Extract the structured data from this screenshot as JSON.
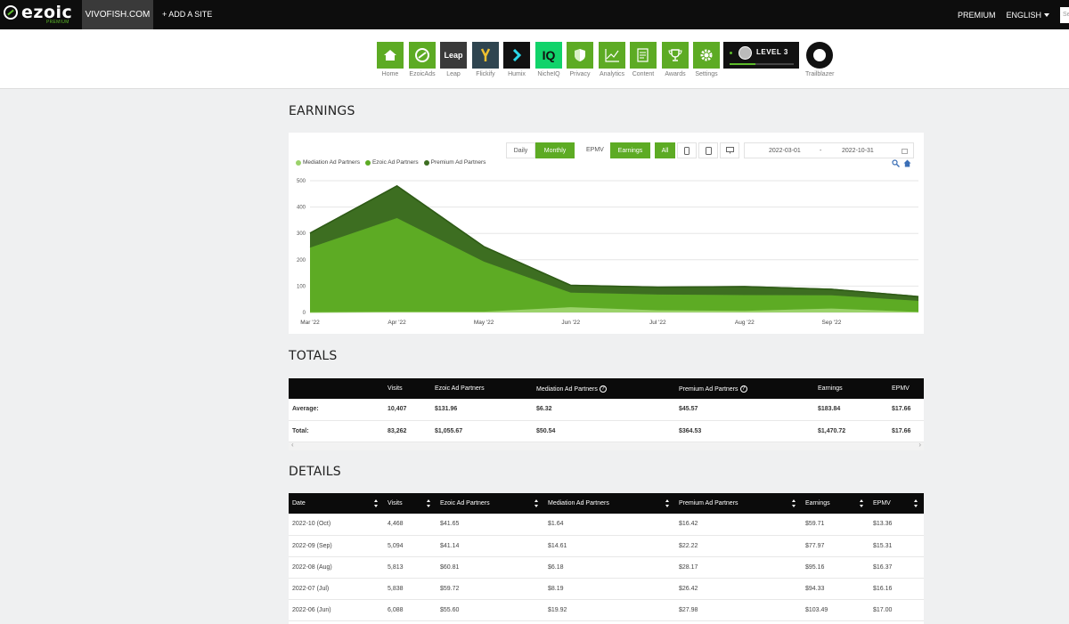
{
  "topbar": {
    "logo_text": "ezoic",
    "logo_sub": "PREMIUM",
    "site": "VIVOFISH.COM",
    "add_site": "+ ADD A SITE",
    "premium": "PREMIUM",
    "language": "ENGLISH",
    "search_placeholder": "Se"
  },
  "apps": [
    {
      "label": "Home",
      "icon": "home-icon"
    },
    {
      "label": "EzoicAds",
      "icon": "ezoicads-icon"
    },
    {
      "label": "Leap",
      "icon": "leap-icon",
      "tile_text": "Leap"
    },
    {
      "label": "Flickify",
      "icon": "flickify-icon"
    },
    {
      "label": "Humix",
      "icon": "humix-icon"
    },
    {
      "label": "NicheIQ",
      "icon": "nicheiq-icon",
      "tile_text": "IQ"
    },
    {
      "label": "Privacy",
      "icon": "shield-icon"
    },
    {
      "label": "Analytics",
      "icon": "analytics-icon"
    },
    {
      "label": "Content",
      "icon": "content-icon"
    },
    {
      "label": "Awards",
      "icon": "trophy-icon"
    },
    {
      "label": "Settings",
      "icon": "gear-icon"
    }
  ],
  "level": {
    "text": "LEVEL 3",
    "progress": 0.4
  },
  "trailblazer": {
    "label": "Trailblazer"
  },
  "earnings": {
    "title": "EARNINGS",
    "controls": {
      "daily": "Daily",
      "monthly": "Monthly",
      "epmv": "EPMV",
      "earnings": "Earnings",
      "all": "All",
      "start_date": "2022-03-01",
      "separator": "-",
      "end_date": "2022-10-31"
    }
  },
  "chart_data": {
    "type": "area",
    "stacked": true,
    "categories": [
      "Mar '22",
      "Apr '22",
      "May '22",
      "Jun '22",
      "Jul '22",
      "Aug '22",
      "Sep '22",
      "Oct '22"
    ],
    "x_tick_labels": [
      "Mar '22",
      "Apr '22",
      "May '22",
      "Jun '22",
      "Jul '22",
      "Aug '22",
      "Sep '22"
    ],
    "series": [
      {
        "name": "Mediation Ad Partners",
        "color": "#9bd26a",
        "values": [
          1,
          3,
          3,
          20,
          8,
          6,
          15,
          2
        ]
      },
      {
        "name": "Ezoic Ad Partners",
        "color": "#5dab24",
        "values": [
          245,
          355,
          190,
          55,
          60,
          60,
          50,
          42
        ]
      },
      {
        "name": "Premium Ad Partners",
        "color": "#3d6e21",
        "values": [
          55,
          122,
          57,
          28,
          28,
          32,
          23,
          16
        ]
      }
    ],
    "yticks": [
      0,
      100,
      200,
      300,
      400,
      500
    ],
    "ylim": [
      0,
      500
    ],
    "grid": true,
    "legend": "top-left"
  },
  "totals": {
    "title": "TOTALS",
    "headers": [
      "",
      "Visits",
      "Ezoic Ad Partners",
      "Mediation Ad Partners",
      "Premium Ad Partners",
      "Earnings",
      "EPMV"
    ],
    "rows": [
      [
        "Average:",
        "10,407",
        "$131.96",
        "$6.32",
        "$45.57",
        "$183.84",
        "$17.66"
      ],
      [
        "Total:",
        "83,262",
        "$1,055.67",
        "$50.54",
        "$364.53",
        "$1,470.72",
        "$17.66"
      ]
    ]
  },
  "details": {
    "title": "DETAILS",
    "headers": [
      "Date",
      "Visits",
      "Ezoic Ad Partners",
      "Mediation Ad Partners",
      "Premium Ad Partners",
      "Earnings",
      "EPMV"
    ],
    "rows": [
      [
        "2022-10 (Oct)",
        "4,468",
        "$41.65",
        "$1.64",
        "$16.42",
        "$59.71",
        "$13.36"
      ],
      [
        "2022-09 (Sep)",
        "5,094",
        "$41.14",
        "$14.61",
        "$22.22",
        "$77.97",
        "$15.31"
      ],
      [
        "2022-08 (Aug)",
        "5,813",
        "$60.81",
        "$6.18",
        "$28.17",
        "$95.16",
        "$16.37"
      ],
      [
        "2022-07 (Jul)",
        "5,838",
        "$59.72",
        "$8.19",
        "$26.42",
        "$94.33",
        "$16.16"
      ],
      [
        "2022-06 (Jun)",
        "6,088",
        "$55.60",
        "$19.92",
        "$27.98",
        "$103.49",
        "$17.00"
      ]
    ]
  }
}
